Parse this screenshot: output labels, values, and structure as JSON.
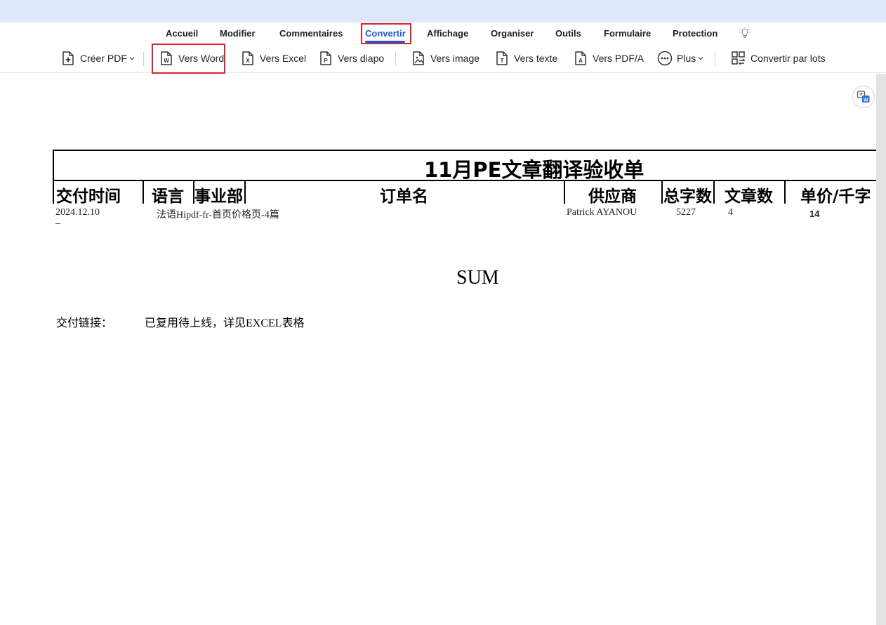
{
  "menu": {
    "tabs": [
      "Accueil",
      "Modifier",
      "Commentaires",
      "Convertir",
      "Affichage",
      "Organiser",
      "Outils",
      "Formulaire",
      "Protection"
    ],
    "active": "Convertir"
  },
  "toolbar": {
    "create_pdf": "Créer PDF",
    "to_word": "Vers Word",
    "to_excel": "Vers Excel",
    "to_slides": "Vers diapo",
    "to_image": "Vers image",
    "to_text": "Vers texte",
    "to_pdfa": "Vers PDF/A",
    "more": "Plus",
    "batch_convert": "Convertir par lots"
  },
  "icons": {
    "create_pdf": "file-plus-icon",
    "to_word": "word-file-icon",
    "to_excel": "excel-file-icon",
    "to_slides": "ppt-file-icon",
    "to_image": "image-file-icon",
    "to_text": "text-file-icon",
    "to_pdfa": "pdfa-file-icon",
    "more": "more-dots-icon",
    "batch_convert": "batch-convert-icon",
    "tip": "lightbulb-icon",
    "translate": "translate-word-icon"
  },
  "colors": {
    "accent": "#1a5bd7",
    "highlight": "#d8232a",
    "title_strip": "#dee7fb"
  },
  "document": {
    "title": "11月PE文章翻译验收单",
    "headers": [
      "交付时间",
      "语言",
      "事业部",
      "订单名",
      "供应商",
      "总字数",
      "文章数",
      "单价/千字"
    ],
    "row": {
      "date": "2024.12.10",
      "language_order": "法语Hipdf-fr-首页价格页-4篇",
      "supplier": "Patrick AYANOU",
      "total_words": "5227",
      "article_count": "4",
      "unit_price": "14"
    },
    "sum_label": "SUM",
    "delivery_link_label": "交付链接：",
    "delivery_link_value": "已复用待上线，详见EXCEL表格"
  }
}
